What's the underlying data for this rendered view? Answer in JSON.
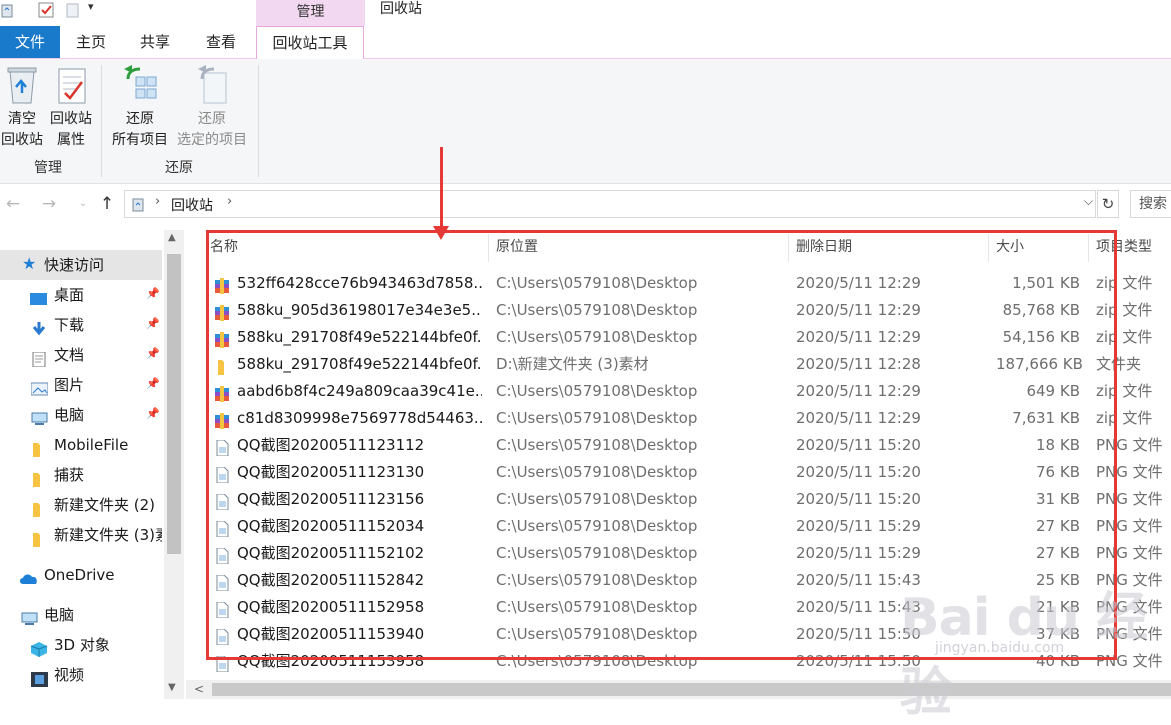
{
  "window": {
    "title": "回收站",
    "context_tab": "管理"
  },
  "ribbon_tabs": [
    "文件",
    "主页",
    "共享",
    "查看",
    "回收站工具"
  ],
  "ribbon": {
    "empty_bin": [
      "清空",
      "回收站"
    ],
    "bin_props": [
      "回收站",
      "属性"
    ],
    "group_manage": "管理",
    "restore_all": [
      "还原",
      "所有项目"
    ],
    "restore_selected": [
      "还原",
      "选定的项目"
    ],
    "group_restore": "还原"
  },
  "address": {
    "path": "回收站",
    "search_placeholder": "搜索"
  },
  "nav": {
    "quick_access": "快速访问",
    "items": [
      "桌面",
      "下载",
      "文档",
      "图片",
      "电脑",
      "MobileFile",
      "捕获",
      "新建文件夹 (2)",
      "新建文件夹 (3)素"
    ],
    "onedrive": "OneDrive",
    "pc": "电脑",
    "pc_items": [
      "3D 对象",
      "视频"
    ]
  },
  "columns": [
    "名称",
    "原位置",
    "删除日期",
    "大小",
    "项目类型"
  ],
  "files": [
    {
      "name": "532ff6428cce76b943463d7858...",
      "loc": "C:\\Users\\0579108\\Desktop",
      "date": "2020/5/11 12:29",
      "size": "1,501 KB",
      "type": "zip 文件",
      "icon": "zip-icon"
    },
    {
      "name": "588ku_905d36198017e34e3e5...",
      "loc": "C:\\Users\\0579108\\Desktop",
      "date": "2020/5/11 12:29",
      "size": "85,768 KB",
      "type": "zip 文件",
      "icon": "zip-icon"
    },
    {
      "name": "588ku_291708f49e522144bfe0f...",
      "loc": "C:\\Users\\0579108\\Desktop",
      "date": "2020/5/11 12:29",
      "size": "54,156 KB",
      "type": "zip 文件",
      "icon": "zip-icon"
    },
    {
      "name": "588ku_291708f49e522144bfe0f...",
      "loc": "D:\\新建文件夹 (3)素材",
      "date": "2020/5/11 12:28",
      "size": "187,666 KB",
      "type": "文件夹",
      "icon": "folder-icon"
    },
    {
      "name": "aabd6b8f4c249a809caa39c41e...",
      "loc": "C:\\Users\\0579108\\Desktop",
      "date": "2020/5/11 12:29",
      "size": "649 KB",
      "type": "zip 文件",
      "icon": "zip-icon"
    },
    {
      "name": "c81d8309998e7569778d54463...",
      "loc": "C:\\Users\\0579108\\Desktop",
      "date": "2020/5/11 12:29",
      "size": "7,631 KB",
      "type": "zip 文件",
      "icon": "zip-icon"
    },
    {
      "name": "QQ截图20200511123112",
      "loc": "C:\\Users\\0579108\\Desktop",
      "date": "2020/5/11 15:20",
      "size": "18 KB",
      "type": "PNG 文件",
      "icon": "png-file-icon"
    },
    {
      "name": "QQ截图20200511123130",
      "loc": "C:\\Users\\0579108\\Desktop",
      "date": "2020/5/11 15:20",
      "size": "76 KB",
      "type": "PNG 文件",
      "icon": "png-file-icon"
    },
    {
      "name": "QQ截图20200511123156",
      "loc": "C:\\Users\\0579108\\Desktop",
      "date": "2020/5/11 15:20",
      "size": "31 KB",
      "type": "PNG 文件",
      "icon": "png-file-icon"
    },
    {
      "name": "QQ截图20200511152034",
      "loc": "C:\\Users\\0579108\\Desktop",
      "date": "2020/5/11 15:29",
      "size": "27 KB",
      "type": "PNG 文件",
      "icon": "png-file-icon"
    },
    {
      "name": "QQ截图20200511152102",
      "loc": "C:\\Users\\0579108\\Desktop",
      "date": "2020/5/11 15:29",
      "size": "27 KB",
      "type": "PNG 文件",
      "icon": "png-file-icon"
    },
    {
      "name": "QQ截图20200511152842",
      "loc": "C:\\Users\\0579108\\Desktop",
      "date": "2020/5/11 15:43",
      "size": "25 KB",
      "type": "PNG 文件",
      "icon": "png-file-icon"
    },
    {
      "name": "QQ截图20200511152958",
      "loc": "C:\\Users\\0579108\\Desktop",
      "date": "2020/5/11 15:43",
      "size": "21 KB",
      "type": "PNG 文件",
      "icon": "png-file-icon"
    },
    {
      "name": "QQ截图20200511153940",
      "loc": "C:\\Users\\0579108\\Desktop",
      "date": "2020/5/11 15:50",
      "size": "37 KB",
      "type": "PNG 文件",
      "icon": "png-file-icon"
    },
    {
      "name": "QQ截图20200511153958",
      "loc": "C:\\Users\\0579108\\Desktop",
      "date": "2020/5/11 15:50",
      "size": "40 KB",
      "type": "PNG 文件",
      "icon": "png-file-icon"
    }
  ],
  "watermark": {
    "main": "Bai du 经验",
    "sub": "jingyan.baidu.com"
  },
  "colors": {
    "accent": "#1979ca",
    "context_tab": "#f2d8f0",
    "highlight": "#e53935"
  }
}
